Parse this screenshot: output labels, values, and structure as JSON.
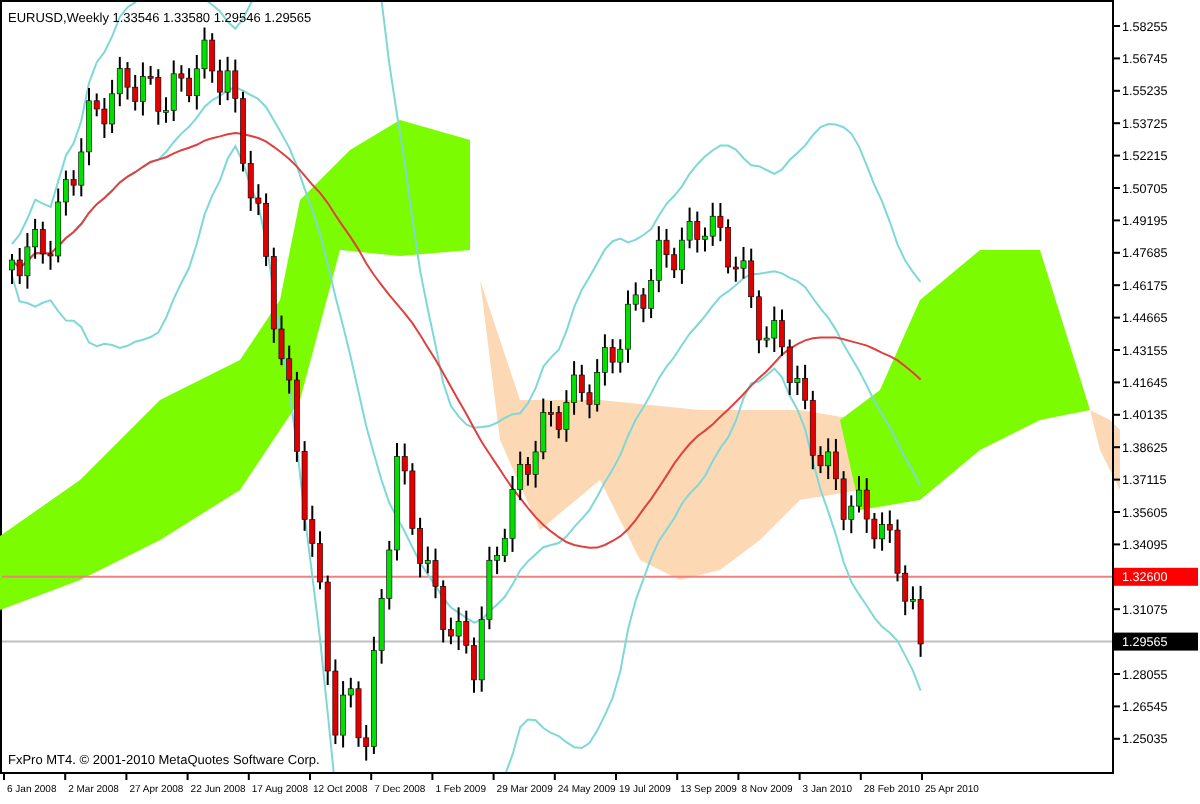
{
  "chart_title": "EURUSD,Weekly  1.33546 1.33580 1.29546 1.29565",
  "copyright": "FxPro MT4. © 2001-2010 MetaQuotes Software Corp.",
  "price_axis": [
    {
      "kind": "tick",
      "text": "1.58255"
    },
    {
      "kind": "tick",
      "text": "1.56745"
    },
    {
      "kind": "tick",
      "text": "1.55235"
    },
    {
      "kind": "tick",
      "text": "1.53725"
    },
    {
      "kind": "tick",
      "text": "1.52215"
    },
    {
      "kind": "tick",
      "text": "1.50705"
    },
    {
      "kind": "tick",
      "text": "1.49195"
    },
    {
      "kind": "tick",
      "text": "1.47685"
    },
    {
      "kind": "tick",
      "text": "1.46175"
    },
    {
      "kind": "tick",
      "text": "1.44665"
    },
    {
      "kind": "tick",
      "text": "1.43155"
    },
    {
      "kind": "tick",
      "text": "1.41645"
    },
    {
      "kind": "tick",
      "text": "1.40135"
    },
    {
      "kind": "tick",
      "text": "1.38625"
    },
    {
      "kind": "tick",
      "text": "1.37115"
    },
    {
      "kind": "tick",
      "text": "1.35605"
    },
    {
      "kind": "tick",
      "text": "1.34095"
    },
    {
      "kind": "line",
      "text": "1.32600"
    },
    {
      "kind": "tick",
      "text": "1.31075"
    },
    {
      "kind": "bid",
      "text": "1.29565"
    },
    {
      "kind": "tick",
      "text": "1.28055"
    },
    {
      "kind": "tick",
      "text": "1.26545"
    },
    {
      "kind": "tick",
      "text": "1.25035"
    }
  ],
  "time_axis": [
    "6 Jan 2008",
    "2 Mar 2008",
    "27 Apr 2008",
    "22 Jun 2008",
    "17 Aug 2008",
    "12 Oct 2008",
    "7 Dec 2008",
    "1 Feb 2009",
    "29 Mar 2009",
    "24 May 2009",
    "19 Jul 2009",
    "13 Sep 2009",
    "8 Nov 2009",
    "3 Jan 2010",
    "28 Feb 2010",
    "25 Apr 2010"
  ]
}
